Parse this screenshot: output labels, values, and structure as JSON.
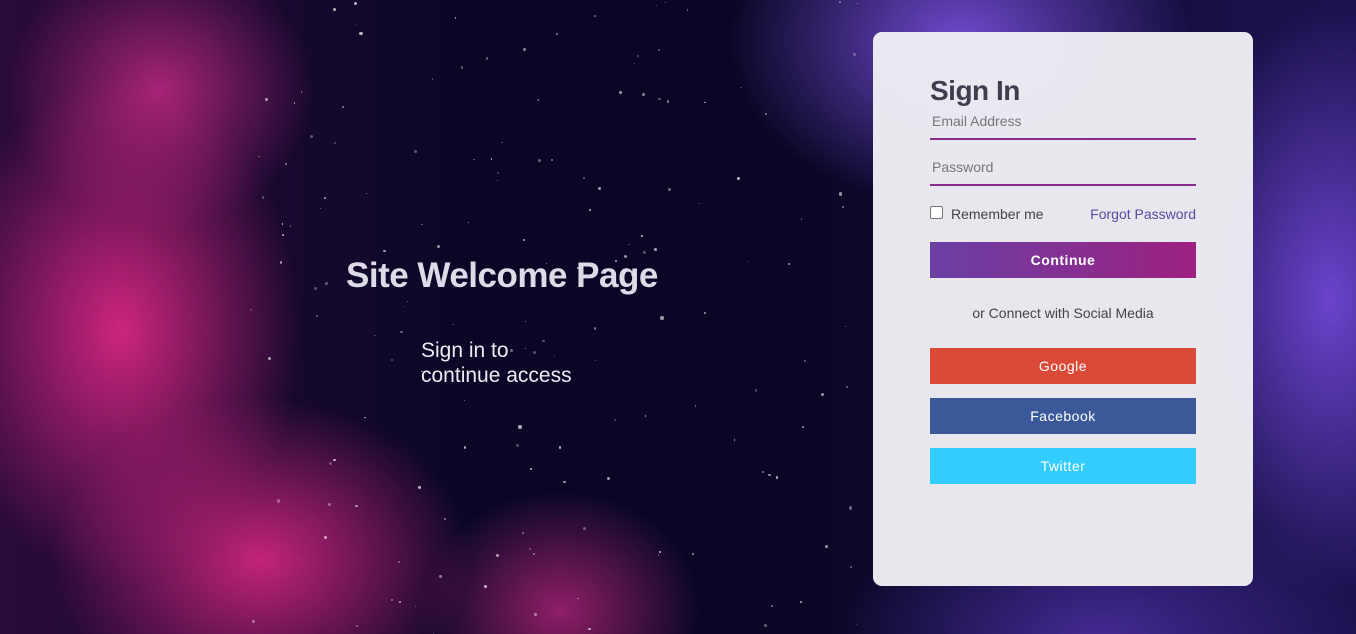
{
  "welcome": {
    "title": "Site Welcome Page",
    "subtitle_line1": "Sign in to",
    "subtitle_line2": "continue access"
  },
  "signin": {
    "title": "Sign In",
    "email_placeholder": "Email Address",
    "password_placeholder": "Password",
    "remember_label": "Remember me",
    "forgot_label": "Forgot Password",
    "continue_label": "Continue",
    "social_text": "or Connect with Social Media",
    "google_label": "Google",
    "facebook_label": "Facebook",
    "twitter_label": "Twitter"
  },
  "colors": {
    "google": "#db4a39",
    "facebook": "#3b5998",
    "twitter": "#33ccff",
    "accent": "#8a2a8c"
  }
}
